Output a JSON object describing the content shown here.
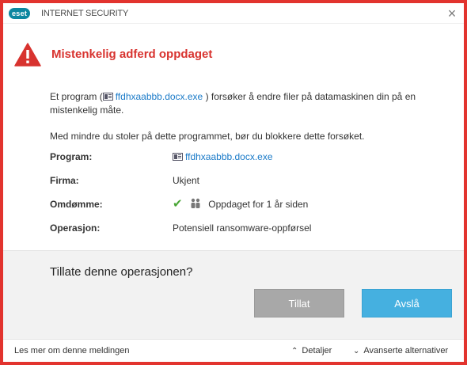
{
  "titlebar": {
    "logo_text": "eset",
    "product_name": "INTERNET SECURITY",
    "close_glyph": "×"
  },
  "alert": {
    "title": "Mistenkelig adferd oppdaget",
    "icon": "warning-triangle-icon",
    "color": "#d8332f"
  },
  "description": {
    "part1": "Et program (",
    "file_link": "ffdhxaabbb.docx.exe",
    "part2": ") forsøker å endre filer på datamaskinen din på en mistenkelig måte.",
    "advice": "Med mindre du stoler på dette programmet, bør du blokkere dette forsøket."
  },
  "details": {
    "program_label": "Program:",
    "program_value": "ffdhxaabbb.docx.exe",
    "company_label": "Firma:",
    "company_value": "Ukjent",
    "reputation_label": "Omdømme:",
    "reputation_value": "Oppdaget for 1 år siden",
    "operation_label": "Operasjon:",
    "operation_value": "Potensiell ransomware-oppførsel"
  },
  "question": "Tillate denne operasjonen?",
  "buttons": {
    "allow": "Tillat",
    "deny": "Avslå"
  },
  "footer": {
    "learn_more": "Les mer om denne meldingen",
    "details": "Detaljer",
    "advanced": "Avanserte alternativer"
  },
  "colors": {
    "border": "#e2332e",
    "link": "#1a7ac8",
    "deny_button": "#45b0e0",
    "allow_button": "#a8a8a8",
    "check": "#49a636"
  }
}
